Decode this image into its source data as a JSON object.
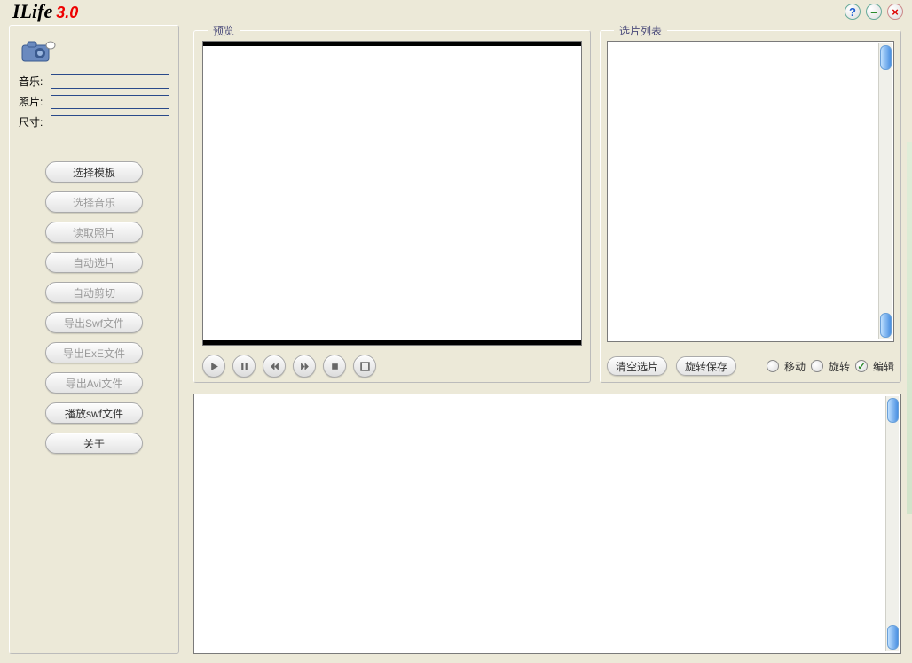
{
  "app": {
    "name": "ILife",
    "version": "3.0"
  },
  "topbar": {
    "help": "?",
    "min": "–",
    "close": "×"
  },
  "sidebar": {
    "fields": {
      "music_label": "音乐:",
      "photo_label": "照片:",
      "size_label": "尺寸:",
      "music_value": "",
      "photo_value": "",
      "size_value": ""
    },
    "buttons": [
      {
        "id": "select-template",
        "label": "选择模板",
        "enabled": true
      },
      {
        "id": "select-music",
        "label": "选择音乐",
        "enabled": false
      },
      {
        "id": "read-photos",
        "label": "读取照片",
        "enabled": false
      },
      {
        "id": "auto-select",
        "label": "自动选片",
        "enabled": false
      },
      {
        "id": "auto-crop",
        "label": "自动剪切",
        "enabled": false
      },
      {
        "id": "export-swf",
        "label": "导出Swf文件",
        "enabled": false
      },
      {
        "id": "export-exe",
        "label": "导出ExE文件",
        "enabled": false
      },
      {
        "id": "export-avi",
        "label": "导出Avi文件",
        "enabled": false
      },
      {
        "id": "play-swf",
        "label": "播放swf文件",
        "enabled": true
      },
      {
        "id": "about",
        "label": "关于",
        "enabled": true
      }
    ]
  },
  "preview": {
    "title": "预览",
    "controls": {
      "play": "play",
      "pause": "pause",
      "rewind": "rewind",
      "forward": "forward",
      "stop": "stop",
      "fullscreen": "fullscreen"
    }
  },
  "selection": {
    "title": "选片列表",
    "clear_label": "清空选片",
    "rotate_save_label": "旋转保存",
    "mode_move": "移动",
    "mode_rotate": "旋转",
    "mode_edit": "编辑",
    "mode_selected": "edit"
  }
}
